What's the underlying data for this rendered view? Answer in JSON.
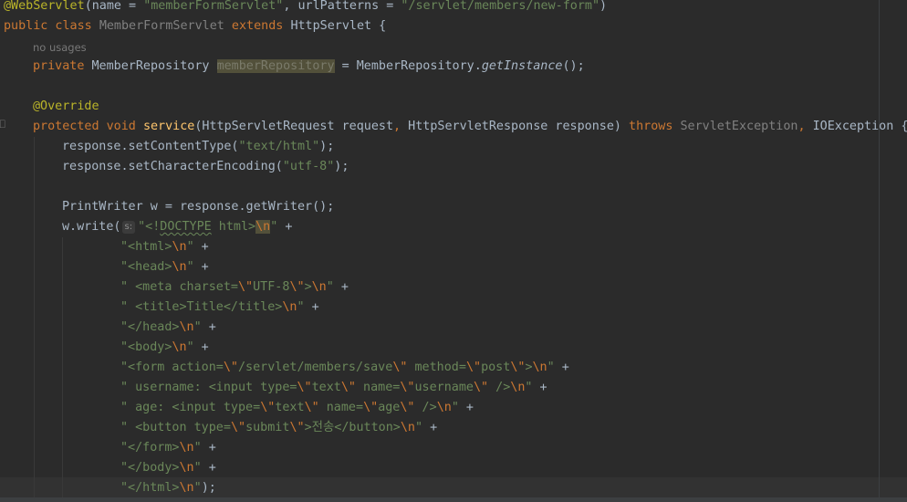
{
  "editor": {
    "hint_no_usages": "no usages",
    "param_hint": "s:",
    "lines": {
      "l1": {
        "ann": "@WebServlet",
        "p1": "(name = ",
        "s1": "\"memberFormServlet\"",
        "p2": ", urlPatterns = ",
        "s2": "\"/servlet/members/new-form\"",
        "p3": ")"
      },
      "l2": {
        "kw": "public class ",
        "cls": "MemberFormServlet",
        "kw2": " extends ",
        "rest": "HttpServlet {"
      },
      "l3": {
        "kw": "private ",
        "type": "MemberRepository ",
        "field": "memberRepository",
        "mid": " = MemberRepository.",
        "call": "getInstance",
        "end": "();"
      },
      "l4": {
        "ann": "@Override"
      },
      "l5": {
        "kw": "protected void ",
        "fn": "service",
        "p1": "(HttpServletRequest request",
        "c1": ", ",
        "p2": "HttpServletResponse response) ",
        "kw2": "throws ",
        "ex1": "ServletException",
        "c2": ", ",
        "ex2": "IOException {"
      },
      "l6": {
        "pre": "response.setContentType(",
        "s": "\"text/html\"",
        "end": ");"
      },
      "l7": {
        "pre": "response.setCharacterEncoding(",
        "s": "\"utf-8\"",
        "end": ");"
      },
      "l8": {
        "text": "PrintWriter w = response.getWriter();"
      },
      "l9": {
        "pre": "w.write(",
        "s1": "\"<!",
        "sq": "DOCTYPE",
        "s2": " html>",
        "esc": "\\n",
        "s3": "\"",
        "plus": " +"
      },
      "l10": {
        "s1": "\"<html>",
        "esc": "\\n",
        "s2": "\"",
        "plus": " +"
      },
      "l11": {
        "s1": "\"<head>",
        "esc": "\\n",
        "s2": "\"",
        "plus": " +"
      },
      "l12": {
        "s1": "\" <meta charset=",
        "e1": "\\\"",
        "s2": "UTF-8",
        "e2": "\\\"",
        "s3": ">",
        "esc": "\\n",
        "s4": "\"",
        "plus": " +"
      },
      "l13": {
        "s1": "\" <title>Title</title>",
        "esc": "\\n",
        "s2": "\"",
        "plus": " +"
      },
      "l14": {
        "s1": "\"</head>",
        "esc": "\\n",
        "s2": "\"",
        "plus": " +"
      },
      "l15": {
        "s1": "\"<body>",
        "esc": "\\n",
        "s2": "\"",
        "plus": " +"
      },
      "l16": {
        "s1": "\"<form action=",
        "e1": "\\\"",
        "s2": "/servlet/members/save",
        "e2": "\\\"",
        "s3": " method=",
        "e3": "\\\"",
        "s4": "post",
        "e4": "\\\"",
        "s5": ">",
        "esc": "\\n",
        "s6": "\"",
        "plus": " +"
      },
      "l17": {
        "s1": "\" username: <input type=",
        "e1": "\\\"",
        "s2": "text",
        "e2": "\\\"",
        "s3": " name=",
        "e3": "\\\"",
        "s4": "username",
        "e4": "\\\"",
        "s5": " />",
        "esc": "\\n",
        "s6": "\"",
        "plus": " +"
      },
      "l18": {
        "s1": "\" age: <input type=",
        "e1": "\\\"",
        "s2": "text",
        "e2": "\\\"",
        "s3": " name=",
        "e3": "\\\"",
        "s4": "age",
        "e4": "\\\"",
        "s5": " />",
        "esc": "\\n",
        "s6": "\"",
        "plus": " +"
      },
      "l19": {
        "s1": "\" <button type=",
        "e1": "\\\"",
        "s2": "submit",
        "e2": "\\\"",
        "s3": ">전송</button>",
        "esc": "\\n",
        "s4": "\"",
        "plus": " +"
      },
      "l20": {
        "s1": "\"</form>",
        "esc": "\\n",
        "s2": "\"",
        "plus": " +"
      },
      "l21": {
        "s1": "\"</body>",
        "esc": "\\n",
        "s2": "\"",
        "plus": " +"
      },
      "l22": {
        "s1": "\"</html>",
        "esc": "\\n",
        "s2": "\"",
        "end": ");"
      }
    }
  },
  "colors": {
    "background": "#2b2b2b",
    "keyword": "#cc7832",
    "string": "#6a8759",
    "annotation": "#bbb529",
    "function": "#ffc66d",
    "default_text": "#a9b7c6"
  }
}
